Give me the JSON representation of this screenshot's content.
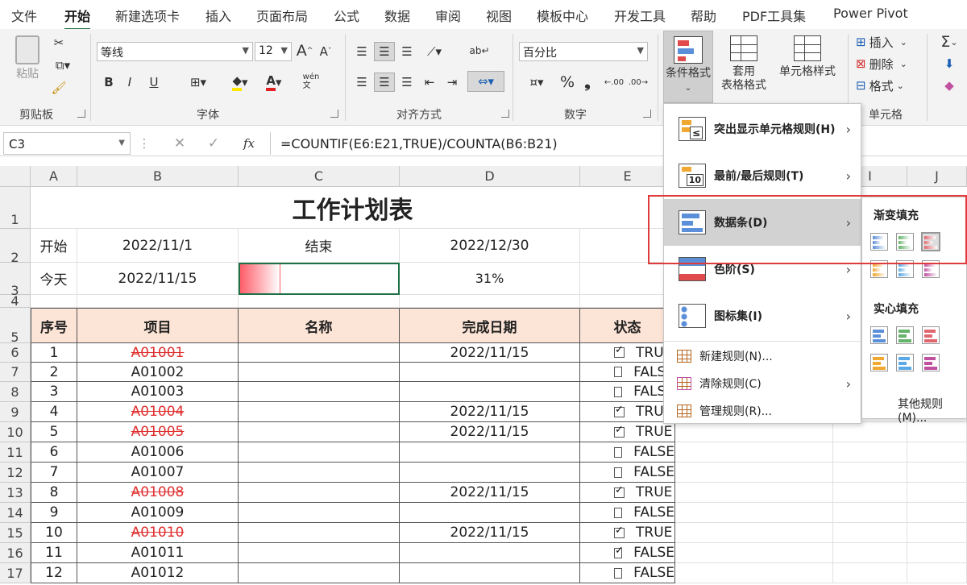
{
  "tabs": [
    "文件",
    "开始",
    "新建选项卡",
    "插入",
    "页面布局",
    "公式",
    "数据",
    "审阅",
    "视图",
    "模板中心",
    "开发工具",
    "帮助",
    "PDF工具集",
    "Power Pivot"
  ],
  "active_tab": "开始",
  "ribbon": {
    "clipboard": {
      "paste": "粘贴",
      "label": "剪贴板"
    },
    "font": {
      "name": "等线",
      "size": "12",
      "bold": "B",
      "italic": "I",
      "underline": "U",
      "grow": "A",
      "shrink": "A",
      "label": "字体"
    },
    "align": {
      "label": "对齐方式"
    },
    "number": {
      "format": "百分比",
      "label": "数字",
      "percent": "%",
      "comma": "❟"
    },
    "styles": {
      "conditional": "条件格式",
      "table_format_1": "套用",
      "table_format_2": "表格格式",
      "cell_style": "单元格样式"
    },
    "cells": {
      "insert": "插入",
      "delete": "删除",
      "format": "格式",
      "label": "单元格"
    },
    "sum": "Σ"
  },
  "formula_bar": {
    "name_box": "C3",
    "cancel": "✕",
    "enter": "✓",
    "fx": "fx",
    "formula": "=COUNTIF(E6:E21,TRUE)/COUNTA(B6:B21)"
  },
  "columns": [
    "A",
    "B",
    "C",
    "D",
    "E",
    "I",
    "J"
  ],
  "rows": [
    "1",
    "2",
    "3",
    "4",
    "5",
    "6",
    "7",
    "8",
    "9",
    "10",
    "11",
    "12",
    "13",
    "14",
    "15",
    "16",
    "17"
  ],
  "sheet": {
    "title": "工作计划表",
    "start_label": "开始",
    "start_date": "2022/11/1",
    "end_label": "结束",
    "end_date": "2022/12/30",
    "today_label": "今天",
    "today_date": "2022/11/15",
    "progress_text": "31%",
    "progress": 0.31,
    "headers": [
      "序号",
      "项目",
      "名称",
      "完成日期",
      "状态"
    ],
    "tasks": [
      {
        "no": "1",
        "item": "A01001",
        "done": true,
        "date": "2022/11/15",
        "status": "TRUE",
        "checked": true
      },
      {
        "no": "2",
        "item": "A01002",
        "done": false,
        "date": "",
        "status": "FALSE",
        "checked": false
      },
      {
        "no": "3",
        "item": "A01003",
        "done": false,
        "date": "",
        "status": "FALSE",
        "checked": false
      },
      {
        "no": "4",
        "item": "A01004",
        "done": true,
        "date": "2022/11/15",
        "status": "TRUE",
        "checked": true
      },
      {
        "no": "5",
        "item": "A01005",
        "done": true,
        "date": "2022/11/15",
        "status": "TRUE",
        "checked": true
      },
      {
        "no": "6",
        "item": "A01006",
        "done": false,
        "date": "",
        "status": "FALSE",
        "checked": false
      },
      {
        "no": "7",
        "item": "A01007",
        "done": false,
        "date": "",
        "status": "FALSE",
        "checked": false
      },
      {
        "no": "8",
        "item": "A01008",
        "done": true,
        "date": "2022/11/15",
        "status": "TRUE",
        "checked": true
      },
      {
        "no": "9",
        "item": "A01009",
        "done": false,
        "date": "",
        "status": "FALSE",
        "checked": false
      },
      {
        "no": "10",
        "item": "A01010",
        "done": true,
        "date": "2022/11/15",
        "status": "TRUE",
        "checked": true
      },
      {
        "no": "11",
        "item": "A01011",
        "done": false,
        "date": "",
        "status": "FALSE",
        "checked": true
      },
      {
        "no": "12",
        "item": "A01012",
        "done": false,
        "date": "",
        "status": "FALSE",
        "checked": false
      }
    ]
  },
  "cf_menu": {
    "highlight": "突出显示单元格规则(H)",
    "topbottom": "最前/最后规则(T)",
    "databar": "数据条(D)",
    "colorscale": "色阶(S)",
    "iconset": "图标集(I)",
    "new_rule": "新建规则(N)...",
    "clear_rule": "清除规则(C)",
    "manage_rule": "管理规则(R)...",
    "topbottom_icon_text": "10",
    "highlight_icon_text": "≤"
  },
  "databar_submenu": {
    "gradient_title": "渐变填充",
    "solid_title": "实心填充",
    "other_rules": "其他规则(M)...",
    "swatch_colors": [
      "#5b8fd9",
      "#63b36a",
      "#e0676f",
      "#f0a830",
      "#5aa9e6",
      "#c050a0"
    ]
  },
  "colors": {
    "accent": "#217346",
    "header_fill": "#fce4d6",
    "strike_red": "#e03030",
    "progress_red": "#ff5a66",
    "highlight_box": "#e03a3a"
  }
}
